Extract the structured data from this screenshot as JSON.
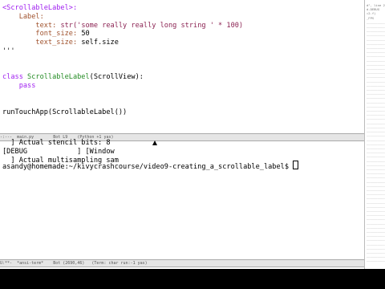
{
  "editor": {
    "lines": [
      {
        "tag": "<ScrollableLabel>:"
      },
      {
        "indent": "    ",
        "key": "Label:"
      },
      {
        "indent": "        ",
        "key": "text: ",
        "rest_str": "str('some really really long string ' * 100)"
      },
      {
        "indent": "        ",
        "key": "font_size: ",
        "rest": "50"
      },
      {
        "indent": "        ",
        "key": "text_size: ",
        "rest": "self.size"
      },
      {
        "plain": "'''"
      },
      {
        "plain": ""
      },
      {
        "plain": ""
      },
      {
        "kw": "class ",
        "cls": "ScrollableLabel",
        "rest": "(ScrollView):"
      },
      {
        "indent": "    ",
        "kw": "pass"
      },
      {
        "plain": ""
      },
      {
        "plain": ""
      },
      {
        "plain": "runTouchApp(ScrollableLabel())"
      }
    ],
    "modeline": "-:---  main.py        Bot L9    (Python +1 yas)"
  },
  "terminal": {
    "lines": [
      "  ] Actual stencil bits: 8",
      "[DEBUG            ] [Window",
      "  ] Actual multisampling sam"
    ],
    "prompt": "asandy@homemade:~/kivycrashcourse/video9-creating_a_scrollable_label$ ",
    "modeline": "U:**-  *ansi-term*    Bot (2690,46)   (Term: char run:-1 yas)"
  },
  "right_strip": {
    "lines": [
      "d\", line 2",
      "d.DEBUG",
      "=2.f)",
      "_FPS",
      "__________",
      "__________",
      "__________",
      "__________",
      "__________",
      "__________",
      "__________",
      "__________",
      "__________",
      "__________",
      "__________",
      "__________",
      "__________",
      "__________",
      "__________",
      "__________",
      "__________",
      "__________",
      "__________",
      "__________",
      "__________",
      "__________",
      "__________",
      "__________",
      "__________",
      "__________",
      "__________",
      "__________",
      "__________",
      "__________",
      "__________",
      "__________",
      "__________",
      "__________",
      "__________",
      "__________",
      "__________",
      "__________",
      "__________",
      "__________",
      "__________",
      "__________",
      "__________",
      "__________",
      "__________",
      "__________",
      "__________",
      "__________",
      "__________",
      "__________",
      "__________",
      "__________",
      "__________",
      "__________",
      "__________",
      "__________",
      "__________",
      "__________"
    ]
  }
}
